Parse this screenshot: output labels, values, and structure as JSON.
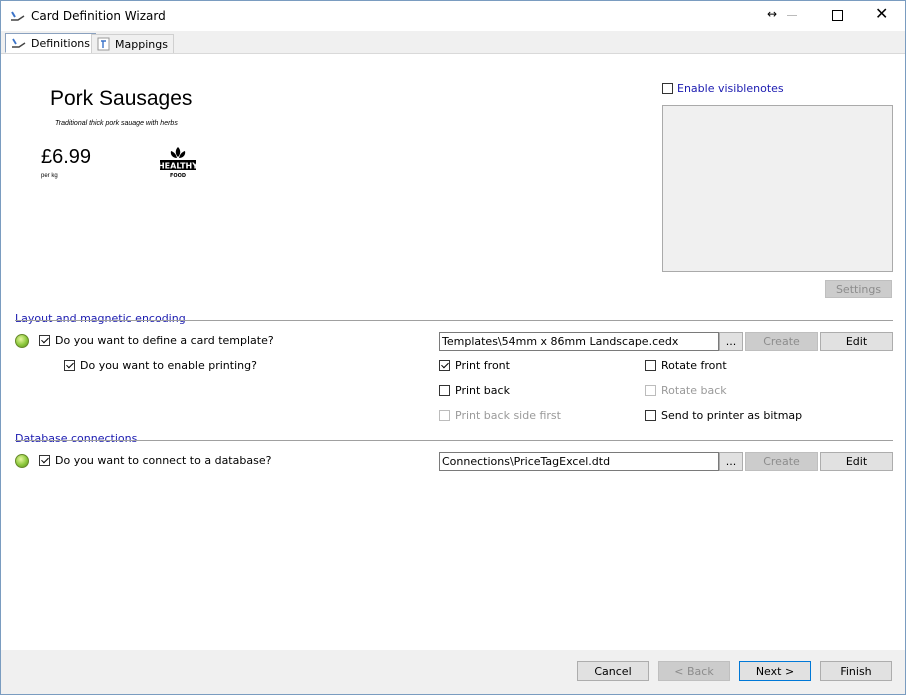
{
  "window": {
    "title": "Card Definition Wizard",
    "resize_glyph": "↔",
    "close_glyph": "✕"
  },
  "tabs": [
    {
      "label": "Definitions",
      "active": true,
      "icon": "wizard-icon"
    },
    {
      "label": "Mappings",
      "active": false,
      "icon": "mappings-icon"
    }
  ],
  "preview": {
    "product_name": "Pork Sausages",
    "description": "Traditional thick pork sauage with herbs",
    "price": "£6.99",
    "unit": "per kg",
    "badge_icon": "healthy-food-icon",
    "badge_text_top": "HEALTHY",
    "badge_text_bottom": "FOOD"
  },
  "notes": {
    "enable_label": "Enable visiblenotes",
    "enabled": false,
    "settings_label": "Settings"
  },
  "layout_group": {
    "title": "Layout and magnetic encoding",
    "define_template_label": "Do you want to define a card template?",
    "define_template_checked": true,
    "enable_printing_label": "Do you want to enable printing?",
    "enable_printing_checked": true,
    "template_path": "Templates\\54mm x 86mm Landscape.cedx",
    "browse_label": "...",
    "create_label": "Create",
    "edit_label": "Edit",
    "print_front_label": "Print front",
    "print_front_checked": true,
    "print_back_label": "Print back",
    "print_back_checked": false,
    "print_back_first_label": "Print back side first",
    "rotate_front_label": "Rotate front",
    "rotate_back_label": "Rotate back",
    "send_bitmap_label": "Send to printer as bitmap"
  },
  "db_group": {
    "title": "Database connections",
    "connect_label": "Do you want to connect to a database?",
    "connect_checked": true,
    "connection_path": "Connections\\PriceTagExcel.dtd",
    "browse_label": "...",
    "create_label": "Create",
    "edit_label": "Edit"
  },
  "footer": {
    "cancel_label": "Cancel",
    "back_label": "< Back",
    "next_label": "Next >",
    "finish_label": "Finish"
  },
  "colors": {
    "accent_link": "#1a1ab0",
    "status_ok": "#8cc83c",
    "default_button_border": "#0078d7"
  }
}
